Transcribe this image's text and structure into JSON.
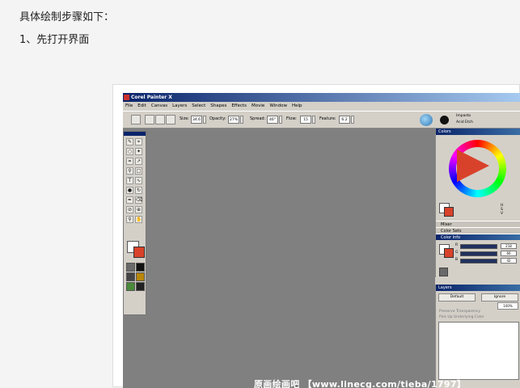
{
  "article": {
    "line1": "具体绘制步骤如下：",
    "line2": "1、先打开界面"
  },
  "app": {
    "title": "Corel Painter X",
    "menu": [
      "File",
      "Edit",
      "Canvas",
      "Layers",
      "Select",
      "Shapes",
      "Effects",
      "Movie",
      "Window",
      "Help"
    ],
    "toolbar": {
      "size_label": "Size:",
      "size_value": "34.6",
      "opacity_label": "Opacity:",
      "opacity_value": "27%",
      "spread_label": "Spread:",
      "spread_value": "46°",
      "flow_label": "Flow:",
      "flow_value": "15",
      "feature_label": "Feature:",
      "feature_value": "6.2",
      "brush_category": "Impasto",
      "brush_variant": "Acid Etch"
    },
    "panels": {
      "colors_title": "Colors",
      "mixer_title": "Mixer",
      "color_sets_title": "Color Sets",
      "color_info_title": "Color Info",
      "hsv_values": [
        "H",
        "S",
        "V"
      ],
      "rgb": [
        {
          "label": "R",
          "value": "218"
        },
        {
          "label": "G",
          "value": "66"
        },
        {
          "label": "B",
          "value": "42"
        }
      ],
      "layers_title": "Layers",
      "layers_composite": "Default",
      "layers_ignore": "Ignore",
      "layers_opacity": "100%",
      "preserve_transparency": "Preserve Transparency",
      "pick_up_color": "Pick Up Underlying Color"
    },
    "colors": {
      "titlebar": "#0a246a",
      "canvas": "#808080",
      "main_color": "#d9422a",
      "chrome": "#d4d0c8"
    }
  },
  "watermark": "原画绘画吧 【www.linecg.com/tieba/1797】"
}
